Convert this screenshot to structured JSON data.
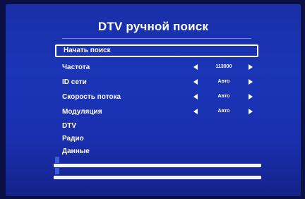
{
  "title": "DTV ручной поиск",
  "menu": {
    "start": "Начать поиск",
    "frequency": {
      "label": "Частота",
      "value": "113000"
    },
    "network_id": {
      "label": "ID сети",
      "value": "Авто"
    },
    "symbol_rate": {
      "label": "Скорость потока",
      "value": "Авто"
    },
    "modulation": {
      "label": "Модуляция",
      "value": "Авто"
    },
    "dtv": "DTV",
    "radio": "Радио",
    "data": "Данные"
  },
  "signal": {
    "strength_label": "",
    "quality_label": ""
  },
  "colors": {
    "background": "#1b35b7",
    "highlight": "#ffffff"
  }
}
